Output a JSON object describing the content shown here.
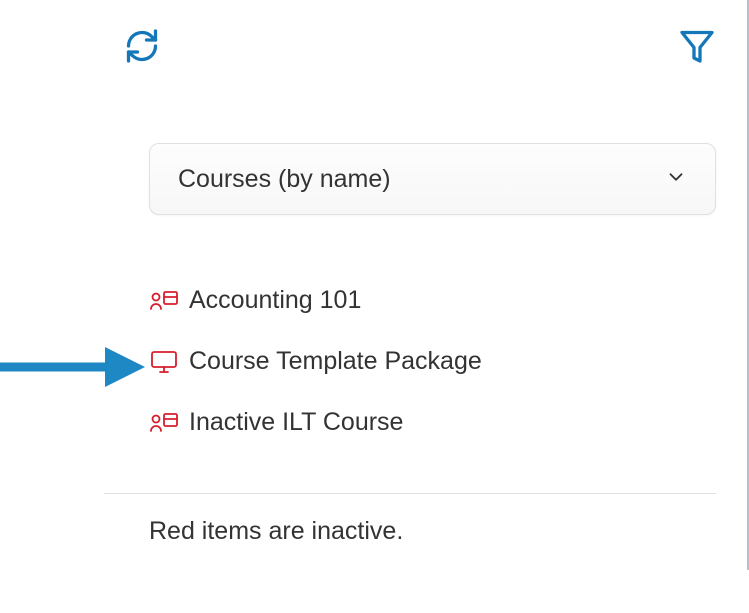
{
  "toolbar": {
    "refresh_icon": "refresh",
    "filter_icon": "filter"
  },
  "dropdown": {
    "selected": "Courses (by name)"
  },
  "courses": [
    {
      "name": "Accounting 101",
      "type": "ilt"
    },
    {
      "name": "Course Template Package",
      "type": "online"
    },
    {
      "name": "Inactive ILT Course",
      "type": "ilt"
    }
  ],
  "hint": "Red items are inactive.",
  "annotation": {
    "target_index": 1
  }
}
